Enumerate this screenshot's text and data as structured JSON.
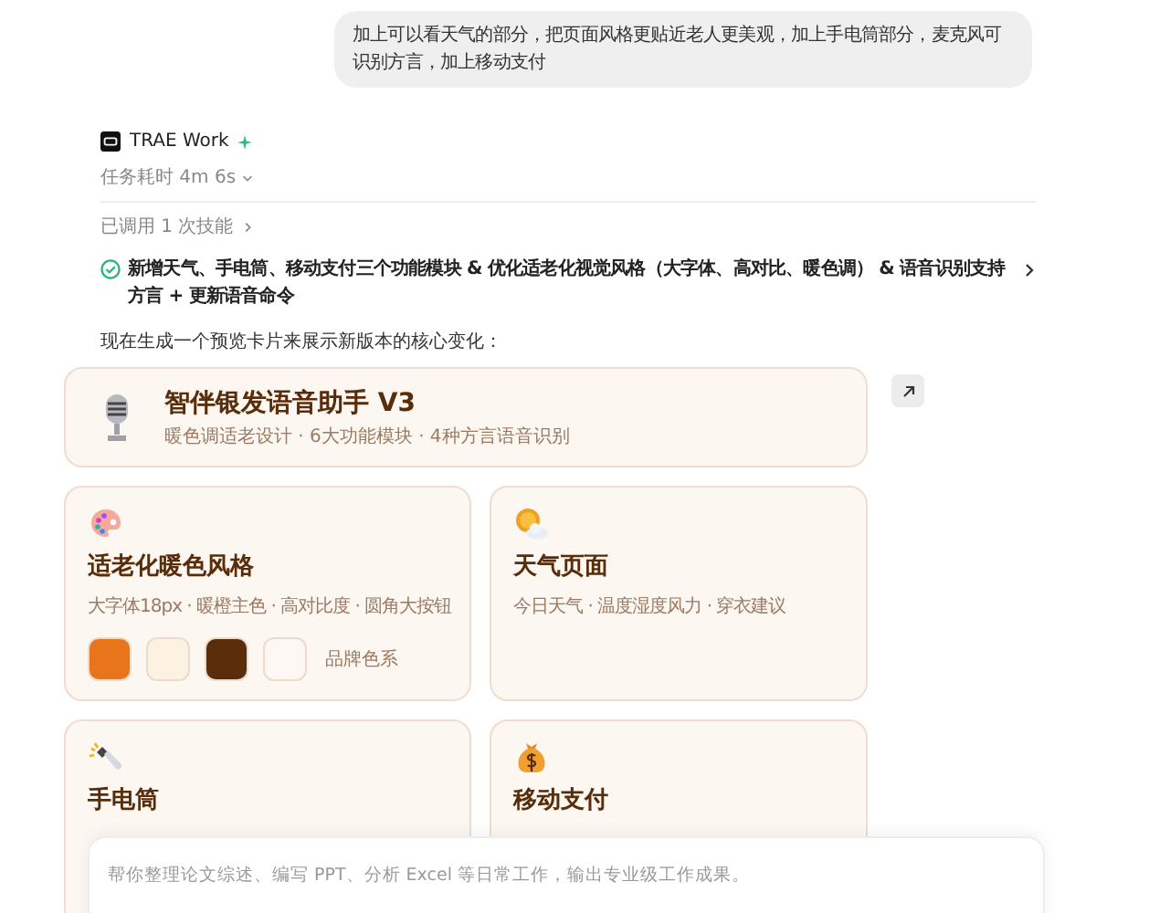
{
  "user_message": {
    "text": "加上可以看天气的部分，把页面风格更贴近老人更美观，加上手电筒部分，麦克风可识别方言，加上移动支付"
  },
  "assistant": {
    "name": "TRAE Work",
    "duration": "任务耗时 4m 6s",
    "skills": "已调用 1 次技能",
    "task": {
      "text": "新增天气、手电筒、移动支付三个功能模块 & 优化适老化视觉风格（大字体、高对比、暖色调） & 语音识别支持方言 + 更新语音命令",
      "done": true
    },
    "intro": "现在生成一个预览卡片来展示新版本的核心变化："
  },
  "preview": {
    "header": {
      "title": "智伴银发语音助手 V3",
      "subtitle": "暖色调适老设计 · 6大功能模块 · 4种方言语音识别"
    },
    "cards": [
      {
        "kind": "style",
        "title": "适老化暖色风格",
        "subtitle": "大字体18px · 暖橙主色 · 高对比度 · 圆角大按钮",
        "swatches": [
          {
            "color": "#e8751a"
          },
          {
            "color": "#fdf1e2"
          },
          {
            "color": "#5a2d0a"
          },
          {
            "color": "#fdf8f3"
          }
        ],
        "swatch_label": "品牌色系"
      },
      {
        "kind": "weather",
        "title": "天气页面",
        "subtitle": "今日天气 · 温度湿度风力 · 穿衣建议"
      },
      {
        "kind": "flashlight",
        "title": "手电筒"
      },
      {
        "kind": "payment",
        "title": "移动支付"
      }
    ]
  },
  "composer": {
    "placeholder": "帮你整理论文综述、编写 PPT、分析 Excel 等日常工作，输出专业级工作成果。"
  }
}
